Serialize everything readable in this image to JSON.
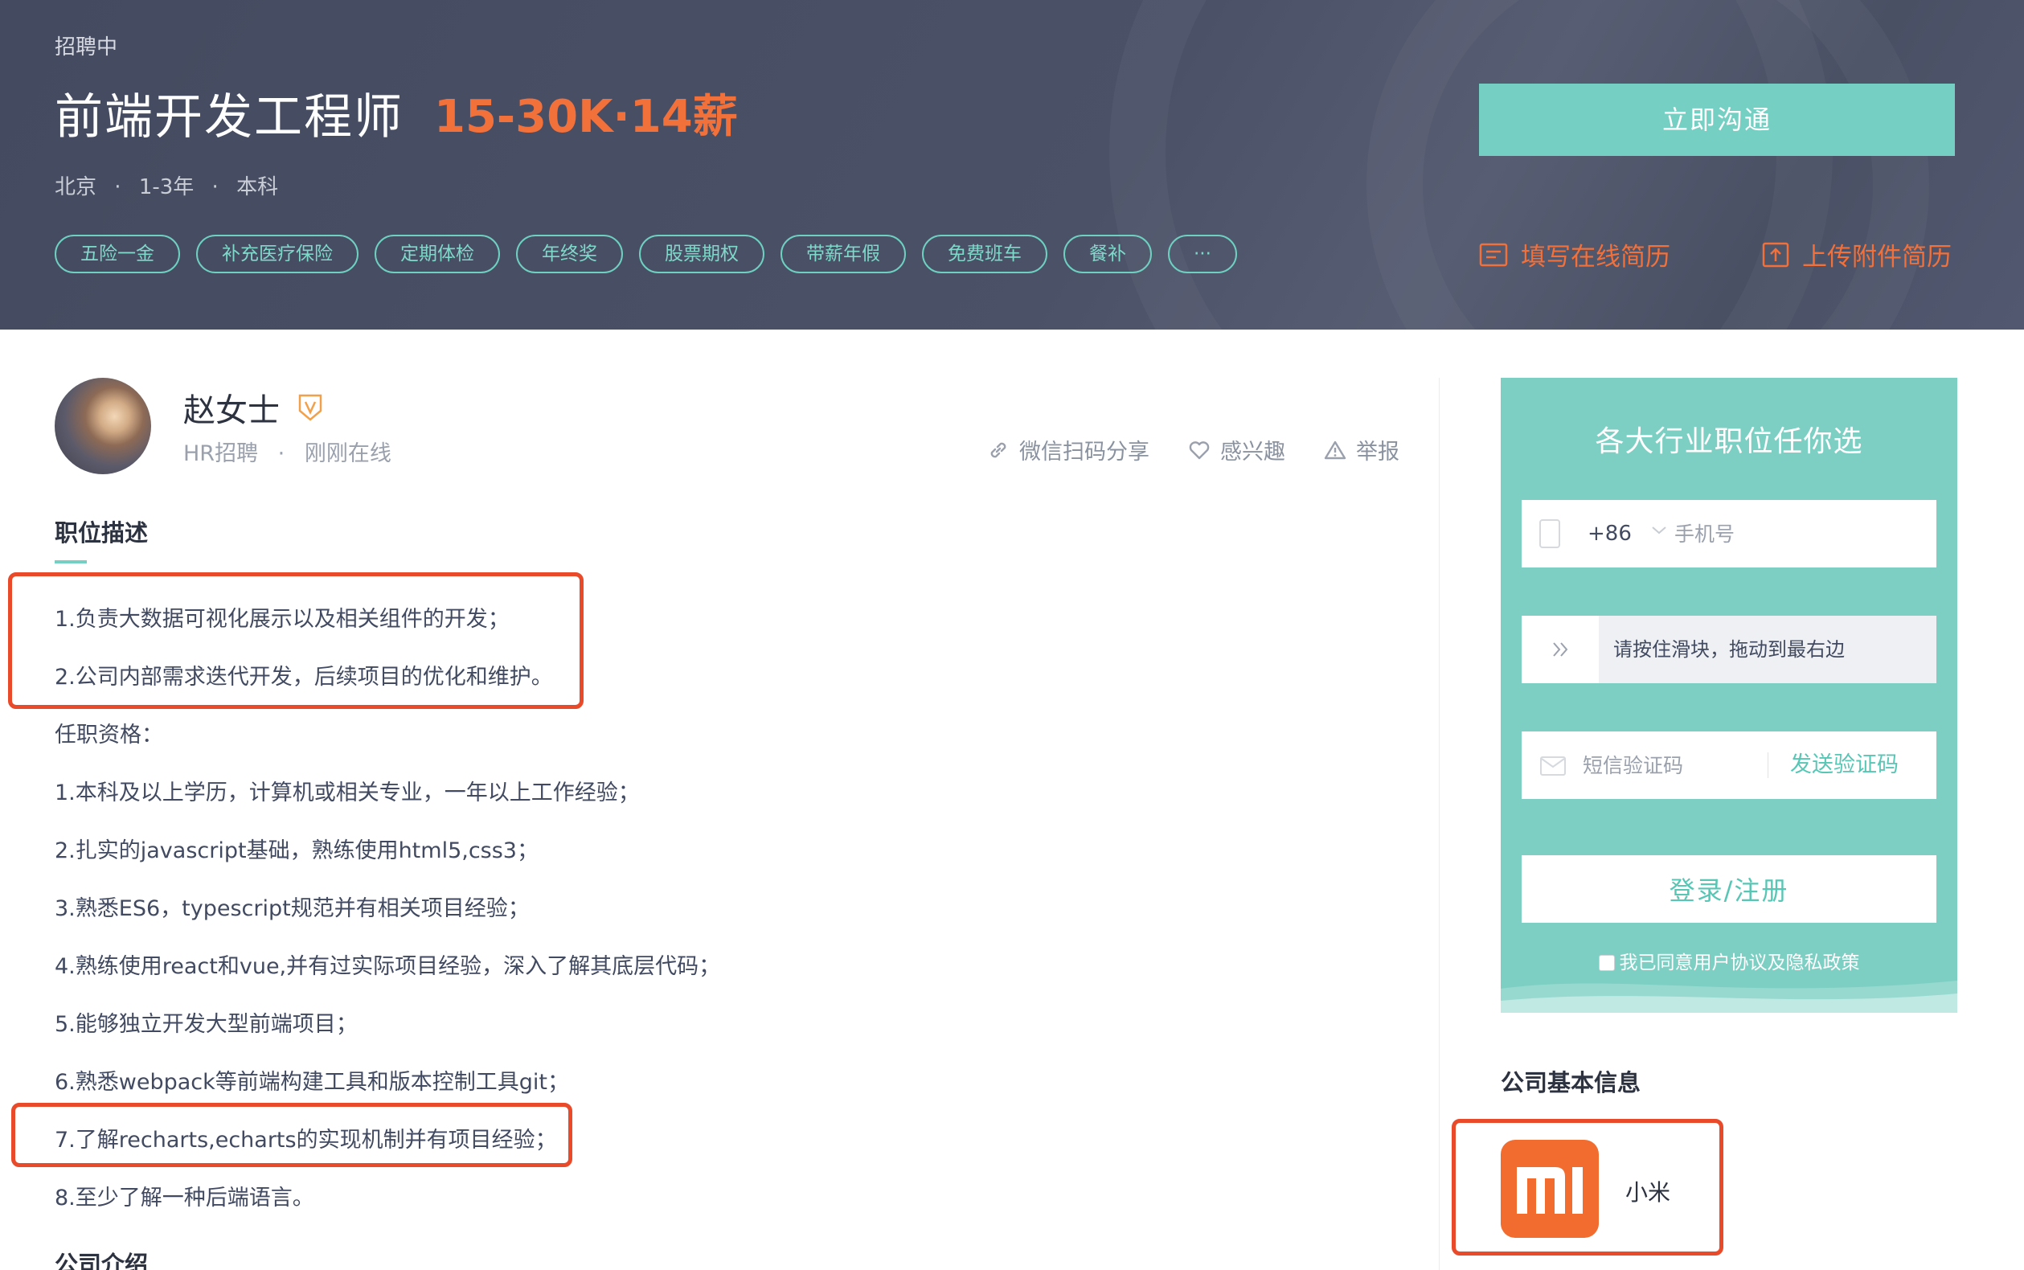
{
  "header": {
    "status": "招聘中",
    "job_title": "前端开发工程师",
    "salary": "15-30K·14薪",
    "location": "北京",
    "experience": "1-3年",
    "education": "本科",
    "meta_separator": "·",
    "tags": [
      "五险一金",
      "补充医疗保险",
      "定期体检",
      "年终奖",
      "股票期权",
      "带薪年假",
      "免费班车",
      "餐补",
      "···"
    ],
    "chat_button": "立即沟通",
    "fill_resume": "填写在线简历",
    "upload_resume": "上传附件简历"
  },
  "hr": {
    "name": "赵女士",
    "role": "HR招聘",
    "separator": "·",
    "online_status": "刚刚在线",
    "actions": {
      "share": "微信扫码分享",
      "interest": "感兴趣",
      "report": "举报"
    }
  },
  "description": {
    "title": "职位描述",
    "lines": [
      "1.负责大数据可视化展示以及相关组件的开发；",
      "2.公司内部需求迭代开发，后续项目的优化和维护。",
      "任职资格：",
      "1.本科及以上学历，计算机或相关专业，一年以上工作经验；",
      "2.扎实的javascript基础，熟练使用html5,css3；",
      "3.熟悉ES6，typescript规范并有相关项目经验；",
      "4.熟练使用react和vue,并有过实际项目经验，深入了解其底层代码；",
      "5.能够独立开发大型前端项目；",
      "6.熟悉webpack等前端构建工具和版本控制工具git；",
      "7.了解recharts,echarts的实现机制并有项目经验；",
      "8.至少了解一种后端语言。"
    ],
    "next_section_title": "公司介绍"
  },
  "login": {
    "title": "各大行业职位任你选",
    "country_code": "+86",
    "phone_placeholder": "手机号",
    "slider_text": "请按住滑块，拖动到最右边",
    "code_placeholder": "短信验证码",
    "send_code": "发送验证码",
    "submit": "登录/注册",
    "agreement": "我已同意用户协议及隐私政策"
  },
  "company": {
    "section_title": "公司基本信息",
    "name": "小米"
  },
  "colors": {
    "banner": "#4a5065",
    "accent_teal": "#75cfc2",
    "salary_orange": "#f2703a",
    "highlight_red": "#e84a2a",
    "xiaomi_orange": "#f16c2e"
  }
}
